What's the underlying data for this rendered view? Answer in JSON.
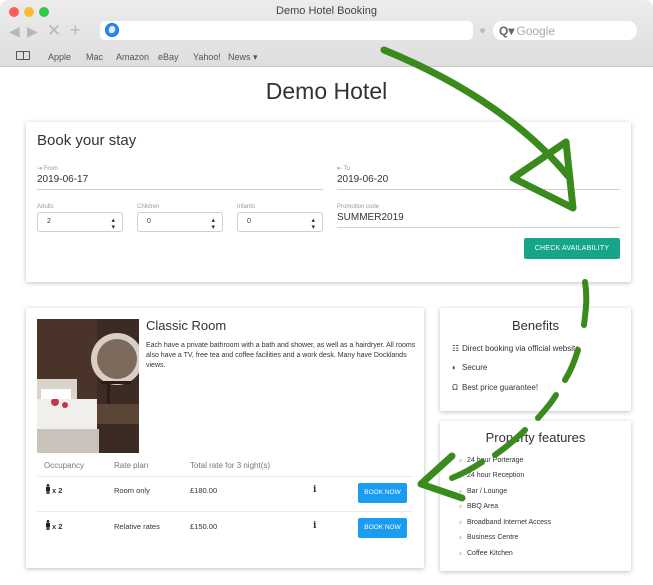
{
  "browser": {
    "window_title": "Demo Hotel Booking",
    "search_placeholder": "Google",
    "bookmarks": [
      "Apple",
      "Mac",
      "Amazon",
      "eBay",
      "Yahoo!",
      "News ▾"
    ]
  },
  "page": {
    "title": "Demo Hotel"
  },
  "booking": {
    "heading": "Book your stay",
    "from": {
      "label": "From",
      "value": "2019-06-17"
    },
    "to": {
      "label": "To",
      "value": "2019-06-20"
    },
    "adults": {
      "label": "Adults",
      "value": "2"
    },
    "children": {
      "label": "Children",
      "value": "0"
    },
    "infants": {
      "label": "Infants",
      "value": "0"
    },
    "promo": {
      "label": "Promotion code",
      "value": "SUMMER2019"
    },
    "check_button": "CHECK AVAILABILITY"
  },
  "room": {
    "name": "Classic Room",
    "description": "Each have a private bathroom with a bath and shower, as well as a hairdryer. All rooms also have a TV, free tea and coffee facilities and a work desk. Many have Docklands views.",
    "columns": [
      "Occupancy",
      "Rate plan",
      "Total rate for 3 night(s)"
    ],
    "rates": [
      {
        "occupancy": "x 2",
        "plan": "Room only",
        "price": "£180.00",
        "info": "i",
        "button": "BOOK NOW"
      },
      {
        "occupancy": "x 2",
        "plan": "Relative rates",
        "price": "£150.00",
        "info": "i",
        "button": "BOOK NOW"
      }
    ]
  },
  "benefits": {
    "title": "Benefits",
    "items": [
      {
        "icon": "sitemap-icon",
        "text": "Direct booking via official website"
      },
      {
        "icon": "shield-icon",
        "text": "Secure"
      },
      {
        "icon": "award-icon",
        "text": "Best price guarantee!"
      }
    ]
  },
  "features": {
    "title": "Property features",
    "items": [
      "24 hour Porterage",
      "24 hour Reception",
      "Bar / Lounge",
      "BBQ Area",
      "Broadband Internet Access",
      "Business Centre",
      "Coffee Kitchen"
    ]
  },
  "colors": {
    "check_button": "#17a589",
    "book_button": "#1a9cf0",
    "annotation_arrow": "#3a8a1e"
  }
}
